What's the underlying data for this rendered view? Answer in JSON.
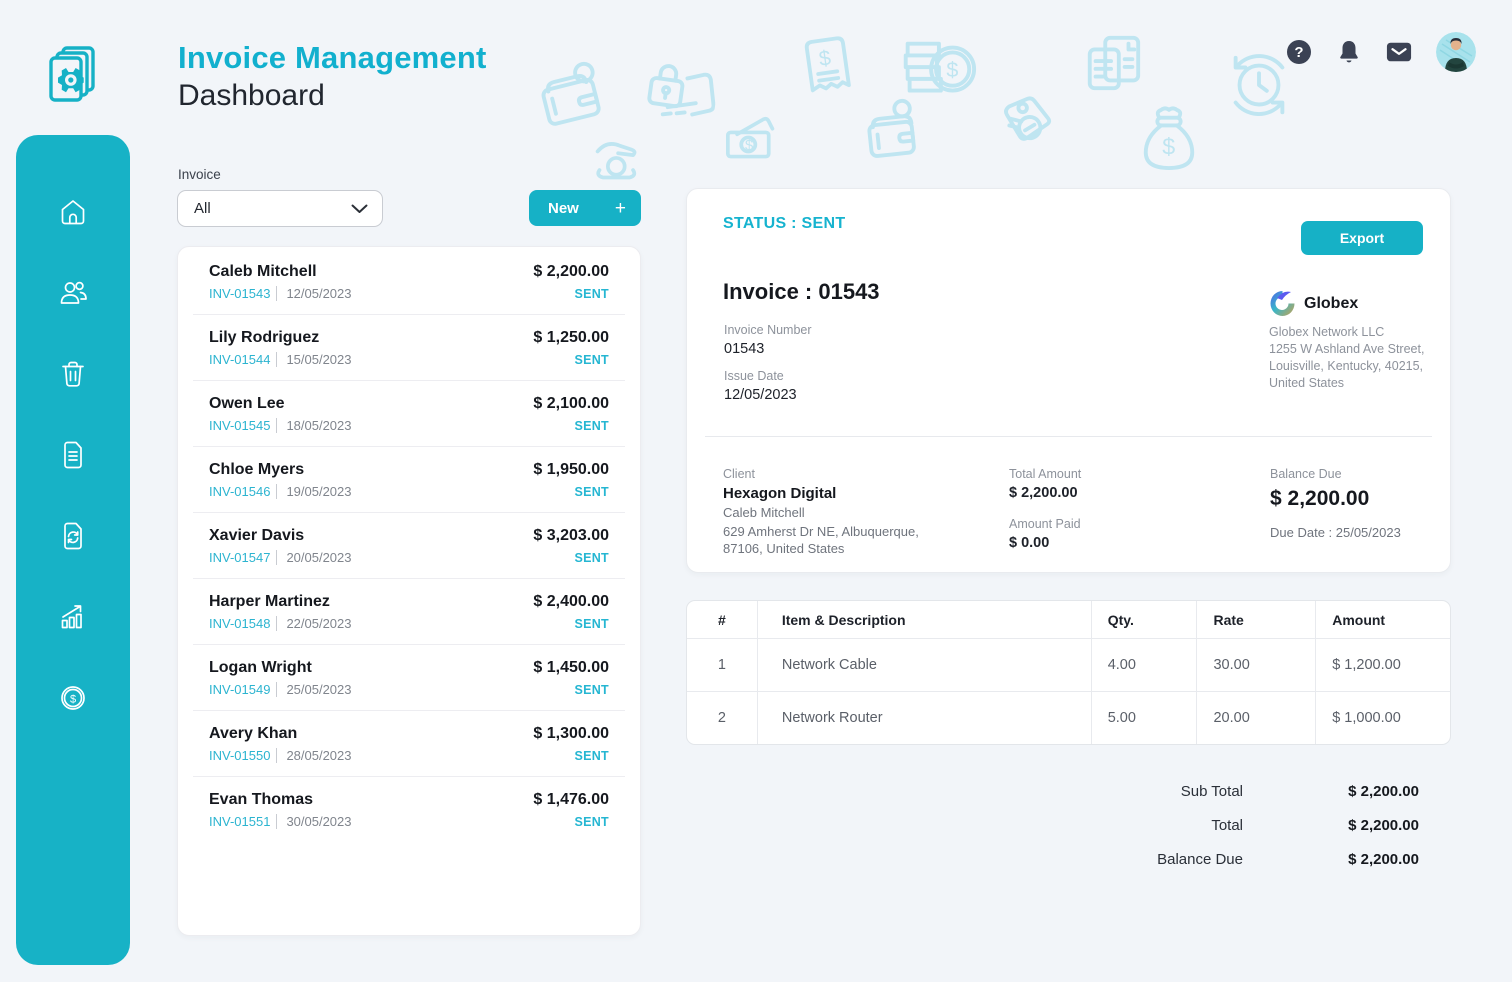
{
  "header": {
    "app_title": "Invoice Management",
    "page_title": "Dashboard"
  },
  "filter": {
    "label": "Invoice",
    "selected_option": "All",
    "new_button_label": "New",
    "new_button_plus": "+"
  },
  "invoice_list": [
    {
      "name": "Caleb Mitchell",
      "number": "INV-01543",
      "date": "12/05/2023",
      "amount": "$ 2,200.00",
      "status": "SENT"
    },
    {
      "name": "Lily Rodriguez",
      "number": "INV-01544",
      "date": "15/05/2023",
      "amount": "$ 1,250.00",
      "status": "SENT"
    },
    {
      "name": "Owen Lee",
      "number": "INV-01545",
      "date": "18/05/2023",
      "amount": "$ 2,100.00",
      "status": "SENT"
    },
    {
      "name": "Chloe Myers",
      "number": "INV-01546",
      "date": "19/05/2023",
      "amount": "$ 1,950.00",
      "status": "SENT"
    },
    {
      "name": "Xavier Davis",
      "number": "INV-01547",
      "date": "20/05/2023",
      "amount": "$ 3,203.00",
      "status": "SENT"
    },
    {
      "name": "Harper Martinez",
      "number": "INV-01548",
      "date": "22/05/2023",
      "amount": "$ 2,400.00",
      "status": "SENT"
    },
    {
      "name": "Logan Wright",
      "number": "INV-01549",
      "date": "25/05/2023",
      "amount": "$ 1,450.00",
      "status": "SENT"
    },
    {
      "name": "Avery Khan",
      "number": "INV-01550",
      "date": "28/05/2023",
      "amount": "$ 1,300.00",
      "status": "SENT"
    },
    {
      "name": "Evan Thomas",
      "number": "INV-01551",
      "date": "30/05/2023",
      "amount": "$ 1,476.00",
      "status": "SENT"
    }
  ],
  "detail": {
    "status_line": "STATUS : SENT",
    "export_label": "Export",
    "invoice_title": "Invoice : 01543",
    "invoice_number_label": "Invoice Number",
    "invoice_number": "01543",
    "issue_date_label": "Issue Date",
    "issue_date": "12/05/2023",
    "company": {
      "name": "Globex",
      "line1": "Globex Network LLC",
      "line2": "1255 W Ashland Ave Street,",
      "line3": "Louisville, Kentucky, 40215,",
      "line4": "United States"
    },
    "client": {
      "label": "Client",
      "company": "Hexagon Digital",
      "contact": "Caleb Mitchell",
      "addr1": "629 Amherst Dr NE, Albuquerque,",
      "addr2": "87106, United States"
    },
    "total_amount_label": "Total Amount",
    "total_amount": "$ 2,200.00",
    "amount_paid_label": "Amount Paid",
    "amount_paid": "$ 0.00",
    "balance_due_label": "Balance Due",
    "balance_due": "$ 2,200.00",
    "due_date_line": "Due Date : 25/05/2023"
  },
  "items_table": {
    "headers": [
      "#",
      "Item & Description",
      "Qty.",
      "Rate",
      "Amount"
    ],
    "rows": [
      [
        "1",
        "Network Cable",
        "4.00",
        "30.00",
        "$ 1,200.00"
      ],
      [
        "2",
        "Network Router",
        "5.00",
        "20.00",
        "$ 1,000.00"
      ]
    ]
  },
  "totals": [
    {
      "label": "Sub Total",
      "value": "$ 2,200.00"
    },
    {
      "label": "Total",
      "value": "$ 2,200.00"
    },
    {
      "label": "Balance Due",
      "value": "$ 2,200.00"
    }
  ],
  "colors": {
    "accent": "#16b1c6",
    "title_accent": "#12b0ce",
    "sidebar": "#17b2c6",
    "dark_icon": "#3b4254",
    "doodle_stroke": "#bfe5f1",
    "page_background": "#f2f5f9"
  }
}
